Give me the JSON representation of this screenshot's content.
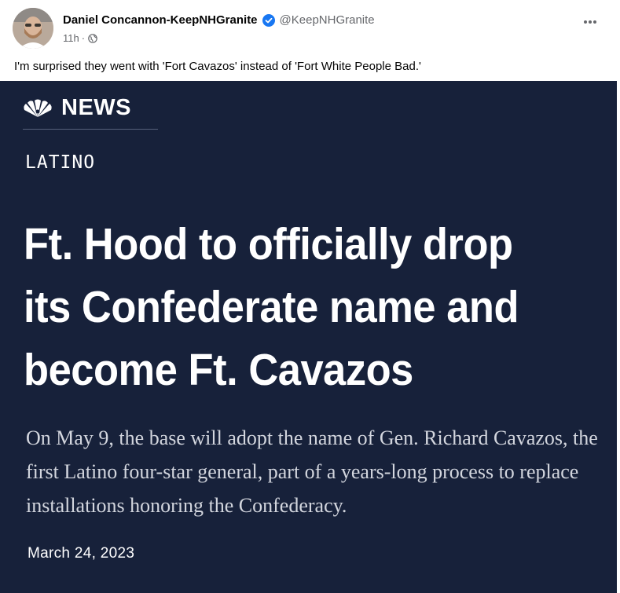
{
  "post": {
    "author_name": "Daniel Concannon-KeepNHGranite",
    "handle": "@KeepNHGranite",
    "time": "11h",
    "meta_separator": "·",
    "text": "I'm surprised they went with 'Fort Cavazos' instead of 'Fort White People Bad.'",
    "icons": {
      "verified": "verified-badge-icon",
      "privacy": "globe-icon",
      "more": "more-options-icon"
    }
  },
  "card": {
    "logo_text": "NEWS",
    "logo_icon": "nbc-peacock-icon",
    "section": "LATINO",
    "headline": "Ft. Hood to officially drop its Confederate name and become Ft. Cavazos",
    "dek": "On May 9, the base will adopt the name of Gen. Richard Cavazos, the first Latino four-star general, part of a years-long process to replace installations honoring the Confederacy.",
    "date": "March 24, 2023"
  },
  "colors": {
    "card_background": "#17213a",
    "verified_blue": "#1877f2",
    "secondary_text": "#65676b"
  }
}
